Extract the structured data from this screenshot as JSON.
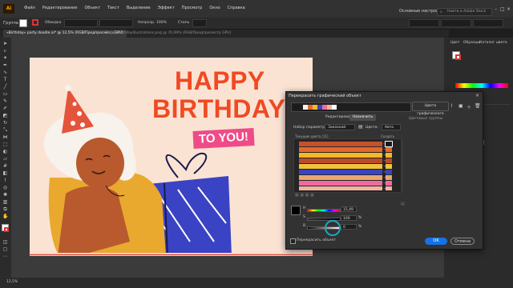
{
  "app": {
    "logo": "Ai",
    "workspace": "Основные настройки",
    "search_placeholder": "Найти в Adobe Stock"
  },
  "menu": [
    "Файл",
    "Редактирование",
    "Объект",
    "Текст",
    "Выделение",
    "Эффект",
    "Просмотр",
    "Окно",
    "Справка"
  ],
  "control_bar": {
    "label": "Группа",
    "stroke_label": "Обводка",
    "opacity_label": "Непрозр.",
    "opacity": "100%",
    "style_label": "Стиль"
  },
  "tabs": [
    {
      "label": "«Birthday» party doodle.ai* @ 12,5% (RGB/Предпросмотр GPU)",
      "active": true
    },
    {
      "label": "HappyBirthdayIllustrations.png @ 76,99% (RGB/Предпросмотр GPU)",
      "active": false
    }
  ],
  "artwork": {
    "line1": "HAPPY",
    "line2": "BIRTHDAY",
    "badge": "TO YOU!"
  },
  "dialog": {
    "title": "Перекрасить графический объект",
    "color_groups_btn": "Цвета графического",
    "tabs": [
      "Редактировать",
      "Назначить"
    ],
    "preset_label": "Набор параметров:",
    "preset_value": "Заказной",
    "colors_label": "Цвета:",
    "colors_value": "Авто",
    "groups_label": "Цветовые группы",
    "current_colors_label": "Текущие цвета (11)",
    "new_label": "Создать",
    "values": {
      "h": "15,49",
      "s": "100",
      "b": "0"
    },
    "value_units": {
      "s": "%",
      "b": "%"
    },
    "recolor_checkbox": "Перекрасить объект",
    "ok": "OK",
    "cancel": "Отмена"
  },
  "recolor_rows": [
    {
      "old": "#c8512d",
      "new": "#1a1a1a"
    },
    {
      "old": "#e26a2c",
      "new": "#e26a2c"
    },
    {
      "old": "#f2b928",
      "new": "#f2b928"
    },
    {
      "old": "#b94d2b",
      "new": "#b94d2b"
    },
    {
      "old": "#f2c23b",
      "new": "#f2c23b"
    },
    {
      "old": "#3a43c4",
      "new": "#3a43c4"
    },
    {
      "old": "#e6a76f",
      "new": "#e6a76f"
    },
    {
      "old": "#f06b9d",
      "new": "#f06b9d"
    },
    {
      "old": "#f3b3a1",
      "new": "#f3b3a1"
    }
  ],
  "colors": {
    "accent": "#1473e6",
    "artboard": "#fbe3d4",
    "title": "#f04a23",
    "badge": "#ef4b87",
    "gift": "#3a43c4",
    "hair": "#f7f2ec",
    "skin": "#b85a2e",
    "shirt": "#e9a92f"
  },
  "right_panel": {
    "tabs": [
      "Цвет",
      "Образцы",
      "Каталог цвета"
    ]
  },
  "statusbar": {
    "zoom": "12,5%"
  }
}
